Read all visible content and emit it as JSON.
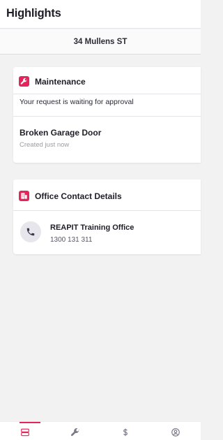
{
  "header": {
    "title": "Highlights"
  },
  "property": {
    "address": "34 Mullens ST"
  },
  "maintenance_card": {
    "title": "Maintenance",
    "icon": "wrench-icon",
    "status": "Your request is waiting for approval",
    "job": {
      "title": "Broken Garage Door",
      "subtitle": "Created just now"
    }
  },
  "office_card": {
    "title": "Office Contact Details",
    "icon": "building-icon",
    "contact": {
      "name": "REAPIT Training Office",
      "phone": "1300 131 311",
      "icon": "phone-icon"
    }
  },
  "bottom_nav": {
    "active": "highlights",
    "items": [
      {
        "id": "highlights",
        "icon": "dashboard-icon"
      },
      {
        "id": "maintenance",
        "icon": "wrench-icon"
      },
      {
        "id": "payments",
        "icon": "dollar-icon"
      },
      {
        "id": "account",
        "icon": "user-circle-icon"
      }
    ]
  },
  "colors": {
    "accent": "#e2265b",
    "background": "#f2f2f3",
    "card": "#ffffff",
    "text": "#1e1e28",
    "muted": "#9a9aa6"
  }
}
